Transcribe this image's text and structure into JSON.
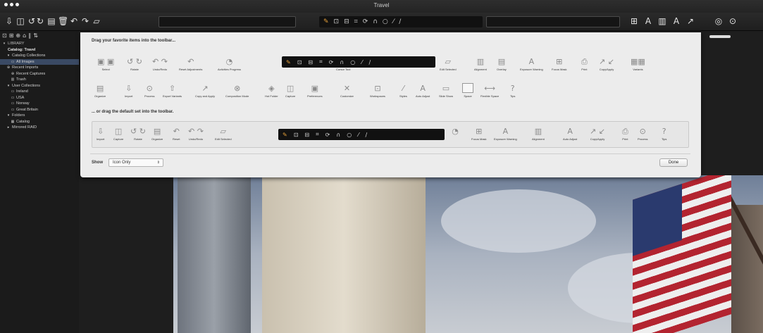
{
  "window": {
    "title": "Travel"
  },
  "icons": {
    "import": "⇩",
    "capture": "◫",
    "rotate_left": "↺",
    "rotate_right": "↻",
    "organize": "▤",
    "trash": "🗑",
    "reset": "↶",
    "undo_redo": "↷",
    "edit_selected": "▱",
    "grid": "⊞",
    "alignment": "▥",
    "text": "A",
    "adjust": "↗",
    "focus": "◎",
    "process": "⊙",
    "cursor_tools": [
      "✎",
      "⊡",
      "⊟",
      "⌗",
      "⟳",
      "∩",
      "○",
      "⁄",
      "∕"
    ]
  },
  "sidebar": {
    "tool_icons": [
      "⊡",
      "⊞",
      "⊕",
      "⌂",
      "∥",
      "⇅"
    ],
    "items": [
      {
        "label": "LIBRARY",
        "style": "head",
        "indent": 0,
        "icon": "▾"
      },
      {
        "label": "Catalog: Travel",
        "style": "bold",
        "indent": 0,
        "icon": ""
      },
      {
        "label": "Catalog Collections",
        "style": "normal",
        "indent": 1,
        "icon": "▾"
      },
      {
        "label": "All Images",
        "style": "sel",
        "indent": 2,
        "icon": "▭"
      },
      {
        "label": "Recent Imports",
        "style": "normal",
        "indent": 1,
        "icon": "⊕"
      },
      {
        "label": "Recent Captures",
        "style": "normal",
        "indent": 2,
        "icon": "⊕"
      },
      {
        "label": "Trash",
        "style": "normal",
        "indent": 2,
        "icon": "▥"
      },
      {
        "label": "User Collections",
        "style": "normal",
        "indent": 1,
        "icon": "▾"
      },
      {
        "label": "Ireland",
        "style": "normal",
        "indent": 2,
        "icon": "▭"
      },
      {
        "label": "USA",
        "style": "normal",
        "indent": 2,
        "icon": "▭"
      },
      {
        "label": "Norway",
        "style": "normal",
        "indent": 2,
        "icon": "▭"
      },
      {
        "label": "Great Britain",
        "style": "normal",
        "indent": 2,
        "icon": "▭"
      },
      {
        "label": "Folders",
        "style": "normal",
        "indent": 1,
        "icon": "▾"
      },
      {
        "label": "Catalog",
        "style": "normal",
        "indent": 2,
        "icon": "▦"
      },
      {
        "label": "Mirrored RAID",
        "style": "normal",
        "indent": 1,
        "icon": "▸"
      }
    ]
  },
  "sheet": {
    "title": "Drag your favorite items into the toolbar...",
    "subtitle": "... or drag the default set into the toolbar.",
    "row1": [
      {
        "label": "Select",
        "icon": "▣ ▣"
      },
      {
        "label": "Rotate",
        "icon": "↺ ↻"
      },
      {
        "label": "Undo/Redo",
        "icon": "↶ ↷"
      },
      {
        "label": "Reset Adjustments",
        "icon": "↶"
      },
      {
        "label": "Activities Progress",
        "icon": "◔"
      },
      {
        "label": "Cursor Tool",
        "icon": ""
      },
      {
        "label": "Edit Selected",
        "icon": "▱"
      },
      {
        "label": "Alignment",
        "icon": "▥"
      },
      {
        "label": "Overlay",
        "icon": "▤"
      },
      {
        "label": "Exposure Warning",
        "icon": "A"
      },
      {
        "label": "Focus Mask",
        "icon": "⊞"
      },
      {
        "label": "Print",
        "icon": "⎙"
      },
      {
        "label": "Copy/Apply",
        "icon": "↗ ↙"
      },
      {
        "label": "Variants",
        "icon": "▦▦"
      }
    ],
    "row2": [
      {
        "label": "Organize",
        "icon": "▤"
      },
      {
        "label": "Import",
        "icon": "⇩"
      },
      {
        "label": "Process",
        "icon": "⊙"
      },
      {
        "label": "Export Variants",
        "icon": "⇧"
      },
      {
        "label": "Copy and Apply",
        "icon": "↗"
      },
      {
        "label": "Composition Mode",
        "icon": "⊗"
      },
      {
        "label": "Hot Folder",
        "icon": "◈"
      },
      {
        "label": "Capture",
        "icon": "◫"
      },
      {
        "label": "Preferences",
        "icon": "▣"
      },
      {
        "label": "Customize",
        "icon": "✕"
      },
      {
        "label": "Workspaces",
        "icon": "⊡"
      },
      {
        "label": "Styles",
        "icon": "⁄"
      },
      {
        "label": "Auto Adjust",
        "icon": "A"
      },
      {
        "label": "Slide Show",
        "icon": "▭"
      },
      {
        "label": "Space",
        "icon": ""
      },
      {
        "label": "Flexible Space",
        "icon": "⟷"
      },
      {
        "label": "Tips",
        "icon": "?"
      }
    ],
    "default_row_left": [
      {
        "label": "Import",
        "icon": "⇩"
      },
      {
        "label": "Capture",
        "icon": "◫"
      },
      {
        "label": "Rotate",
        "icon": "↺ ↻"
      },
      {
        "label": "Organize",
        "icon": "▤"
      },
      {
        "label": "Reset",
        "icon": "↶"
      },
      {
        "label": "Undo/Redo",
        "icon": "↶ ↷"
      },
      {
        "label": "Edit Selected",
        "icon": "▱"
      }
    ],
    "default_row_right": [
      {
        "label": "Focus Mask",
        "icon": "⊞"
      },
      {
        "label": "Exposure Warning",
        "icon": "A"
      },
      {
        "label": "Alignment",
        "icon": "▥"
      },
      {
        "label": "Auto Adjust",
        "icon": "A"
      },
      {
        "label": "Copy/Apply",
        "icon": "↗ ↙"
      },
      {
        "label": "Print",
        "icon": "⎙"
      },
      {
        "label": "Process",
        "icon": "⊙"
      },
      {
        "label": "Tips",
        "icon": "?"
      }
    ],
    "show_label": "Show",
    "show_value": "Icon Only",
    "done_label": "Done"
  },
  "colors": {
    "accent_cursor": "#e8a23a",
    "selection": "#3a4a64",
    "sheet_bg": "#ececec"
  }
}
